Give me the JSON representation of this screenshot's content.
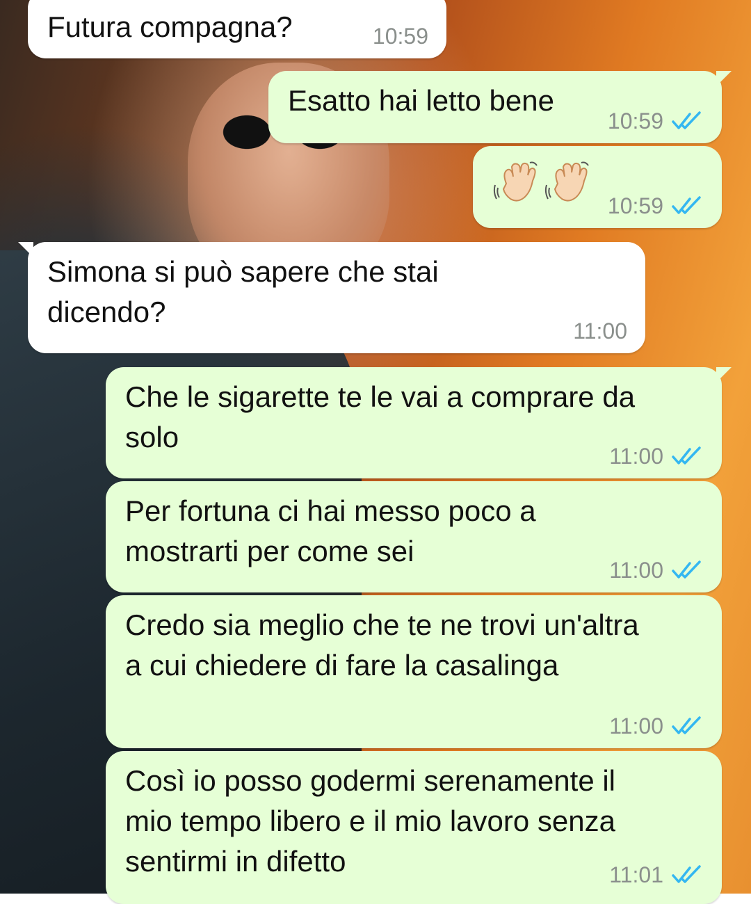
{
  "messages": [
    {
      "id": "m1",
      "direction": "in",
      "text": "Futura compagna?",
      "time": "10:59"
    },
    {
      "id": "m2",
      "direction": "out",
      "text": "Esatto hai letto bene",
      "time": "10:59",
      "status_icon": "double-check-read"
    },
    {
      "id": "m3",
      "direction": "out",
      "emoji": [
        "waving-hand",
        "waving-hand"
      ],
      "time": "10:59",
      "status_icon": "double-check-read"
    },
    {
      "id": "m4",
      "direction": "in",
      "text": "Simona si può sapere che stai\ndicendo?",
      "time": "11:00"
    },
    {
      "id": "m5",
      "direction": "out",
      "text": "Che le sigarette te le vai a comprare da\nsolo",
      "time": "11:00",
      "status_icon": "double-check-read"
    },
    {
      "id": "m6",
      "direction": "out",
      "text": "Per fortuna ci hai messo poco a\nmostrarti per come sei",
      "time": "11:00",
      "status_icon": "double-check-read"
    },
    {
      "id": "m7",
      "direction": "out",
      "text": "Credo sia meglio che te ne trovi un'altra\na cui chiedere di fare la casalinga",
      "time": "11:00",
      "status_icon": "double-check-read"
    },
    {
      "id": "m8",
      "direction": "out",
      "text": "Così io posso godermi serenamente il\nmio tempo libero e il mio lavoro senza\nsentirmi in difetto",
      "time": "11:01",
      "status_icon": "double-check-read"
    }
  ],
  "colors": {
    "incoming_bubble": "#ffffff",
    "outgoing_bubble": "#e6ffd6",
    "timestamp": "#8a8f8c",
    "read_ticks": "#34b7f1"
  }
}
